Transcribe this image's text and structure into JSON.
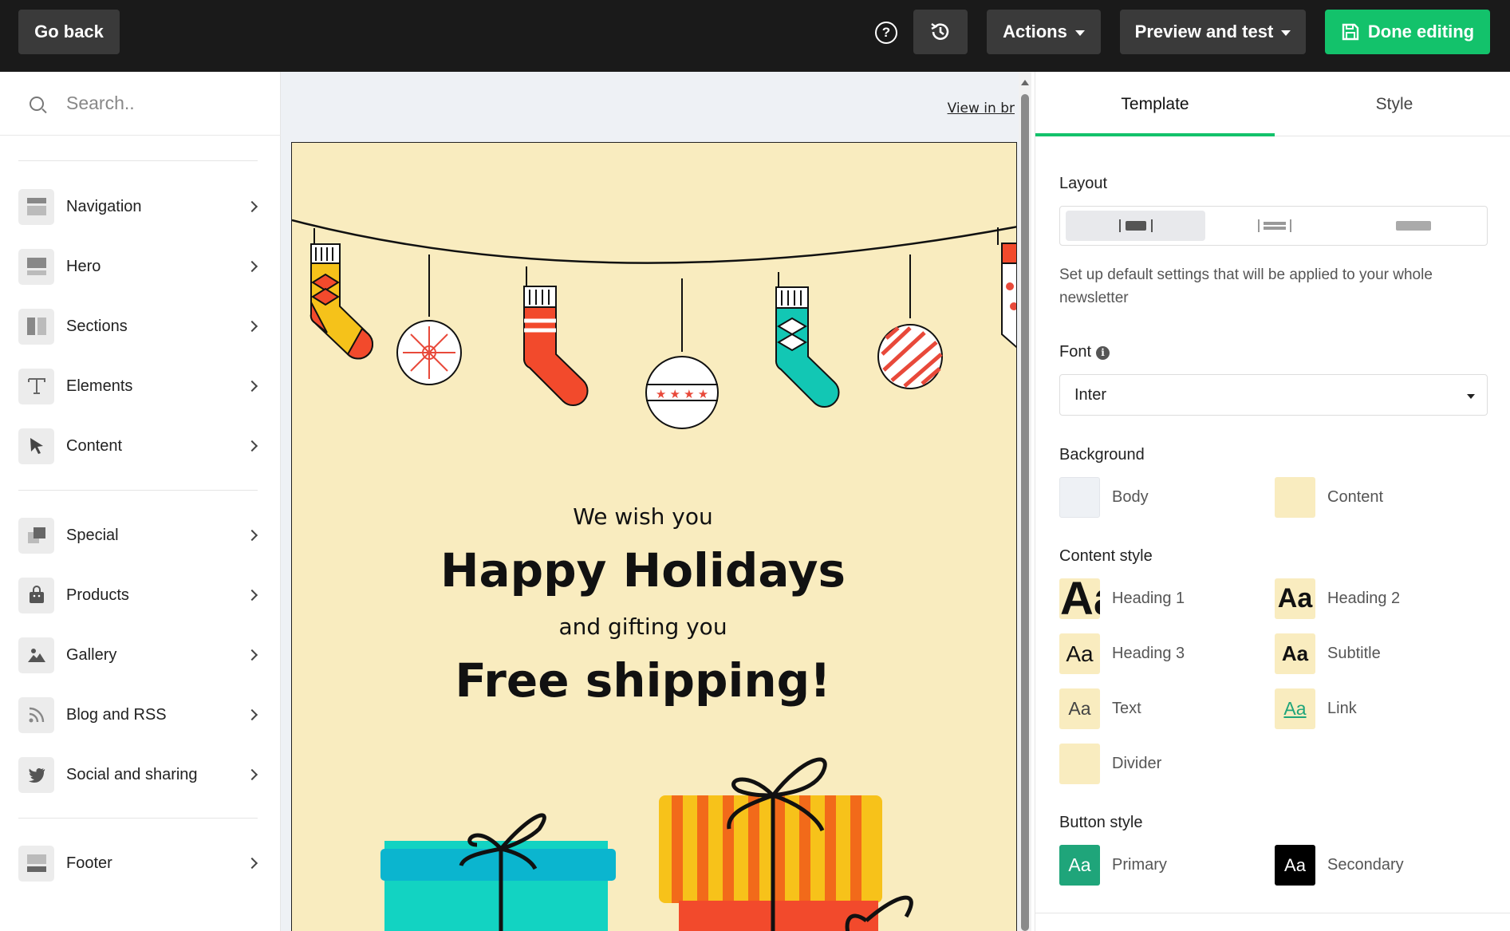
{
  "topbar": {
    "go_back": "Go back",
    "help_glyph": "?",
    "actions": "Actions",
    "preview": "Preview and test",
    "done": "Done editing"
  },
  "sidebar": {
    "search_placeholder": "Search..",
    "items": [
      {
        "label": "Navigation",
        "icon": "navigation-icon"
      },
      {
        "label": "Hero",
        "icon": "hero-icon"
      },
      {
        "label": "Sections",
        "icon": "sections-icon"
      },
      {
        "label": "Elements",
        "icon": "text-t-icon"
      },
      {
        "label": "Content",
        "icon": "cursor-icon"
      },
      {
        "label": "Special",
        "icon": "special-icon"
      },
      {
        "label": "Products",
        "icon": "shopping-bag-icon"
      },
      {
        "label": "Gallery",
        "icon": "image-icon"
      },
      {
        "label": "Blog and RSS",
        "icon": "rss-icon"
      },
      {
        "label": "Social and sharing",
        "icon": "twitter-icon"
      },
      {
        "label": "Footer",
        "icon": "footer-icon"
      }
    ]
  },
  "canvas": {
    "view_link": "View in br",
    "line1": "We wish you",
    "line2": "Happy Holidays",
    "line3": "and gifting you",
    "line4": "Free shipping!",
    "background_color": "#f9ecbf"
  },
  "panel": {
    "tabs": [
      "Template",
      "Style"
    ],
    "layout_title": "Layout",
    "description": "Set up default settings that will be applied to your whole newsletter",
    "font_title": "Font",
    "font_value": "Inter",
    "background_title": "Background",
    "background": [
      {
        "label": "Body",
        "color": "#eef1f5"
      },
      {
        "label": "Content",
        "color": "#f9ecbf"
      }
    ],
    "content_style_title": "Content style",
    "content_styles": [
      {
        "sample": "Aa",
        "label": "Heading 1"
      },
      {
        "sample": "Aa",
        "label": "Heading 2"
      },
      {
        "sample": "Aa",
        "label": "Heading 3"
      },
      {
        "sample": "Aa",
        "label": "Subtitle"
      },
      {
        "sample": "Aa",
        "label": "Text"
      },
      {
        "sample": "Aa",
        "label": "Link"
      },
      {
        "sample": "",
        "label": "Divider"
      }
    ],
    "button_style_title": "Button style",
    "button_styles": [
      {
        "sample": "Aa",
        "label": "Primary",
        "color": "#1fa57a"
      },
      {
        "sample": "Aa",
        "label": "Secondary",
        "color": "#000000"
      }
    ],
    "accent": "#13c26b"
  }
}
